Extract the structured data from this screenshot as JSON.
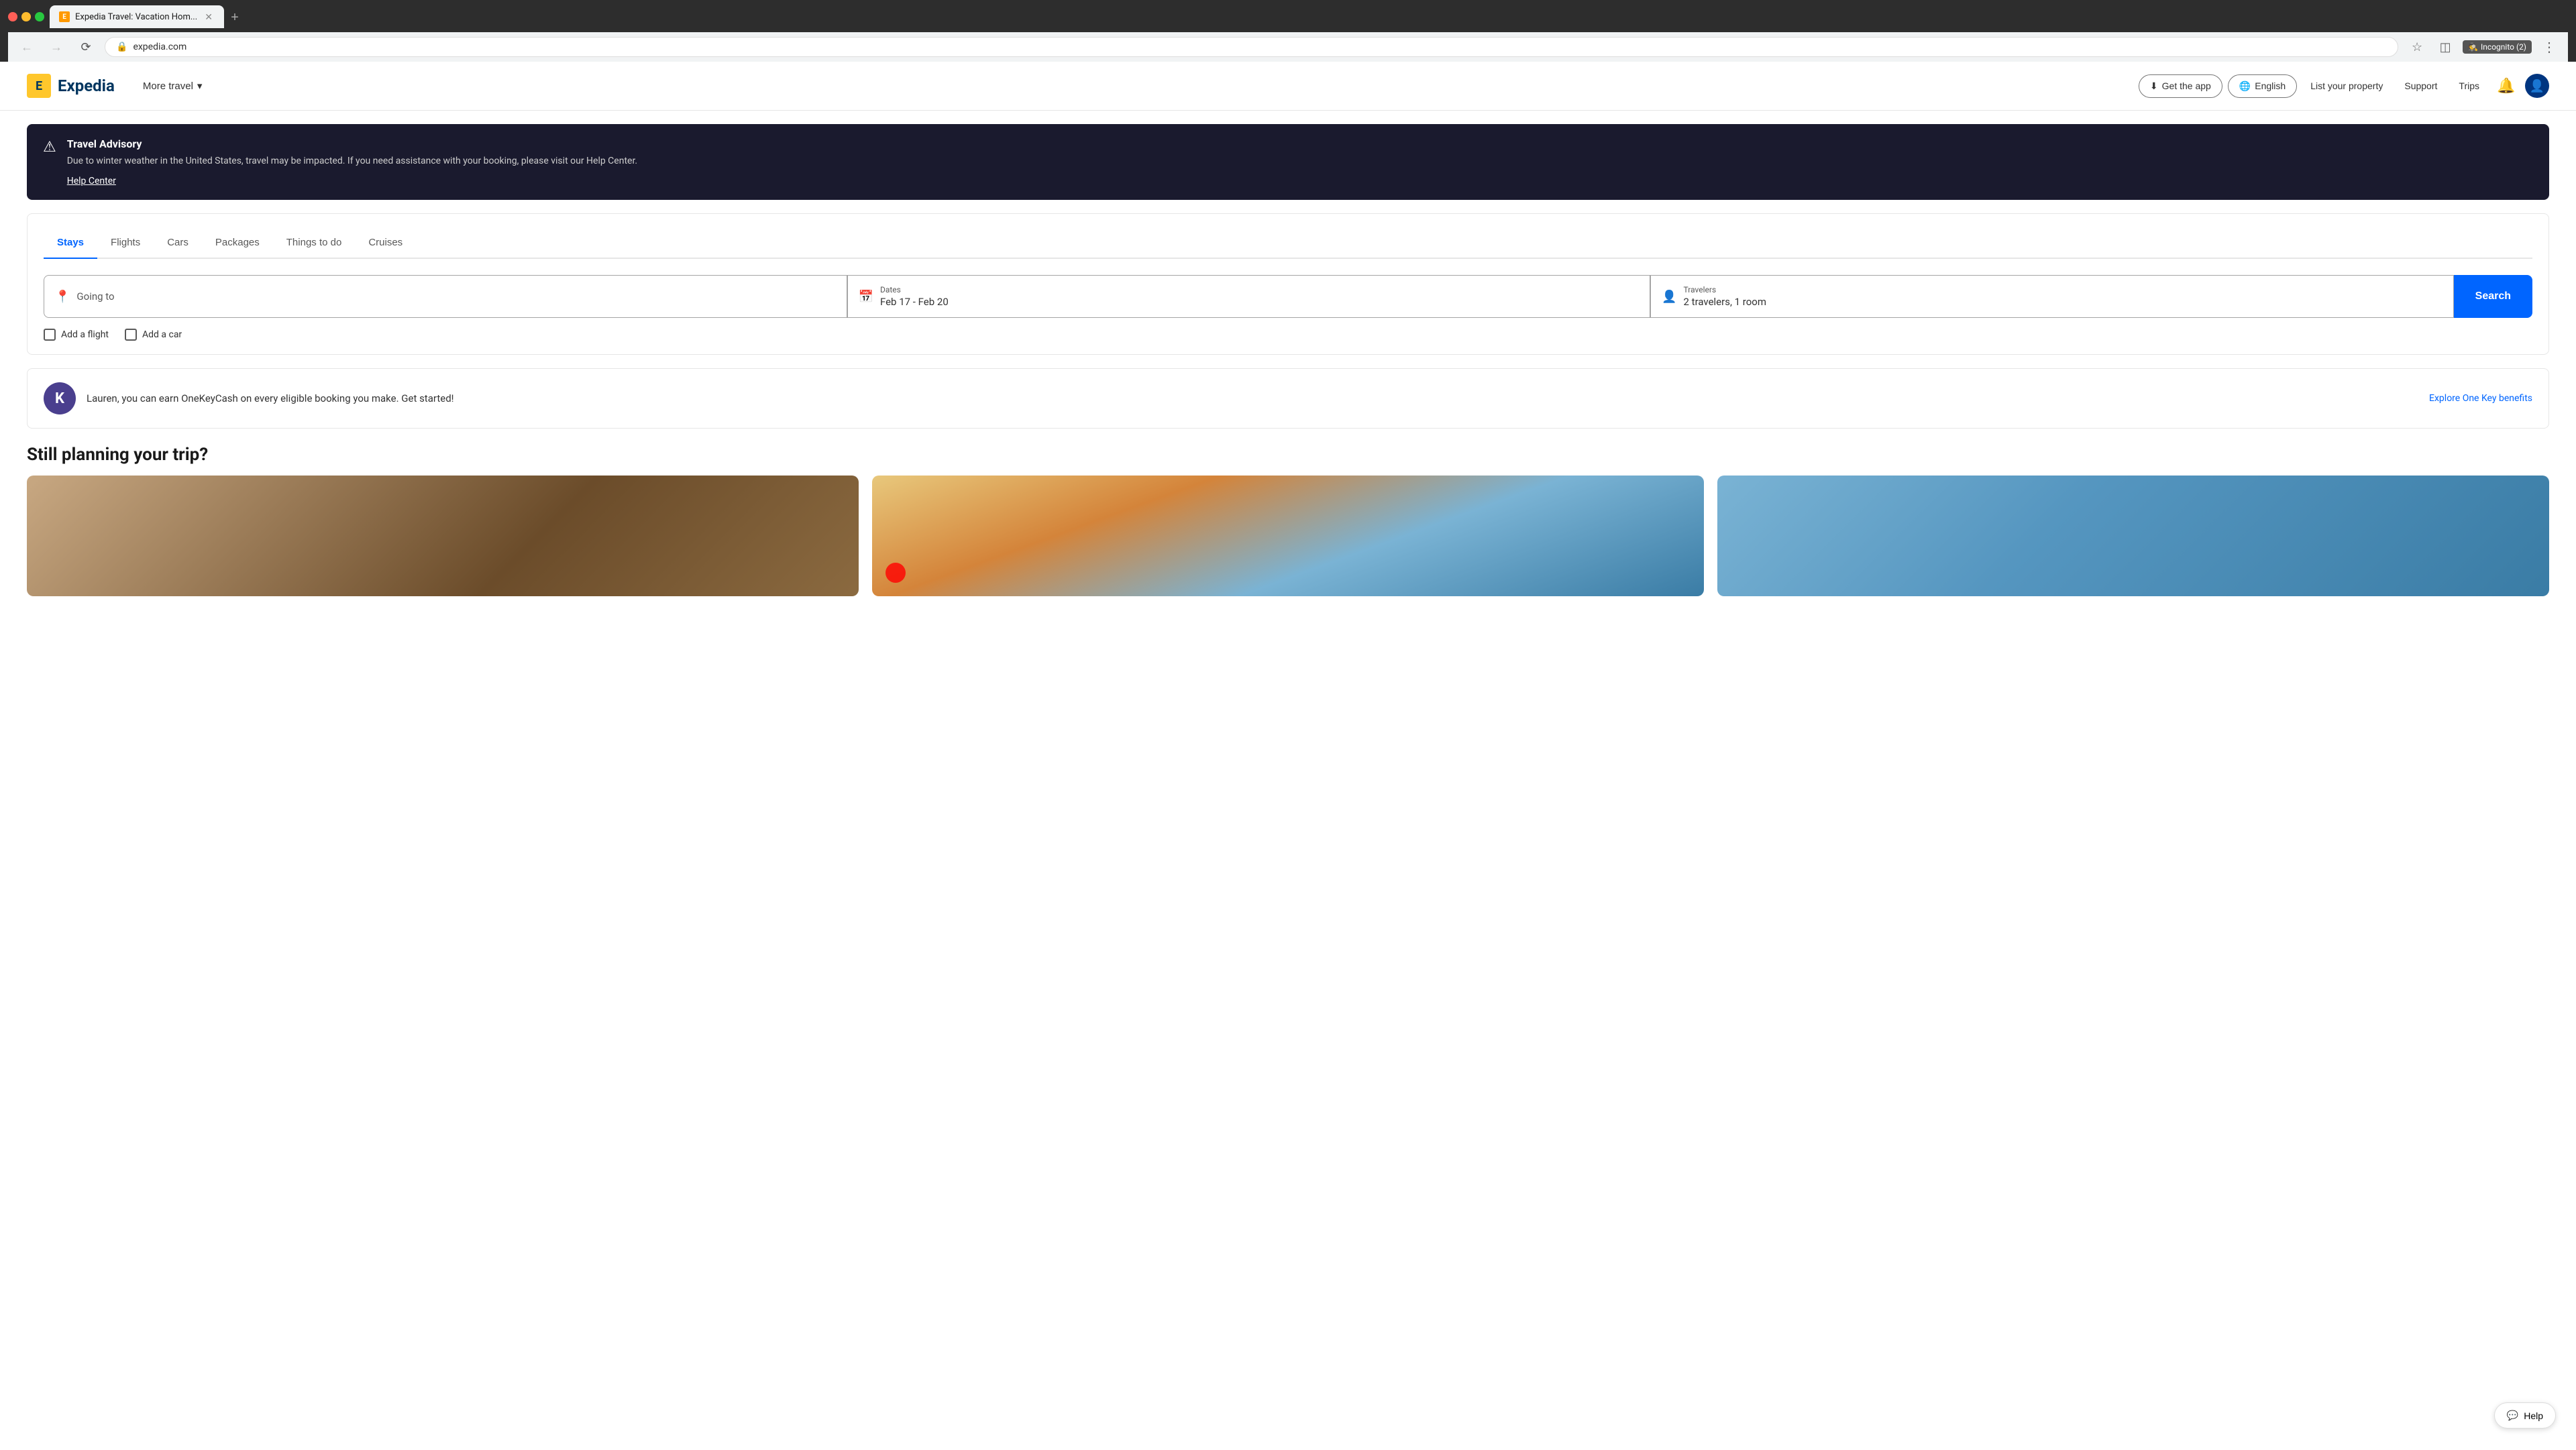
{
  "browser": {
    "tabs": [
      {
        "id": "tab-1",
        "favicon": "E",
        "title": "Expedia Travel: Vacation Hom...",
        "active": true
      }
    ],
    "new_tab_label": "+",
    "address": "expedia.com",
    "back_tooltip": "Back",
    "forward_tooltip": "Forward",
    "reload_tooltip": "Reload",
    "bookmark_icon": "bookmark",
    "profile_icon": "person",
    "incognito_label": "Incognito (2)",
    "more_icon": "⋮"
  },
  "navbar": {
    "logo_letter": "E",
    "logo_text": "Expedia",
    "more_travel_label": "More travel",
    "get_app_label": "Get the app",
    "english_label": "English",
    "list_property_label": "List your property",
    "support_label": "Support",
    "trips_label": "Trips",
    "bell_icon": "bell",
    "user_icon": "person"
  },
  "advisory": {
    "icon": "⚠",
    "title": "Travel Advisory",
    "text": "Due to winter weather in the United States, travel may be impacted. If you need assistance with your booking, please visit our Help Center.",
    "link_label": "Help Center"
  },
  "search_widget": {
    "tabs": [
      {
        "id": "stays",
        "label": "Stays",
        "active": true
      },
      {
        "id": "flights",
        "label": "Flights",
        "active": false
      },
      {
        "id": "cars",
        "label": "Cars",
        "active": false
      },
      {
        "id": "packages",
        "label": "Packages",
        "active": false
      },
      {
        "id": "things",
        "label": "Things to do",
        "active": false
      },
      {
        "id": "cruises",
        "label": "Cruises",
        "active": false
      }
    ],
    "destination_placeholder": "Going to",
    "dates_label": "Dates",
    "dates_value": "Feb 17 - Feb 20",
    "travelers_label": "Travelers",
    "travelers_value": "2 travelers, 1 room",
    "search_label": "Search",
    "add_flight_label": "Add a flight",
    "add_car_label": "Add a car"
  },
  "onekey": {
    "avatar_letter": "K",
    "message": "Lauren, you can earn OneKeyCash on every eligible booking you make. Get started!",
    "link_label": "Explore One Key benefits"
  },
  "section": {
    "title": "Still planning your trip?"
  },
  "help": {
    "label": "Help"
  }
}
